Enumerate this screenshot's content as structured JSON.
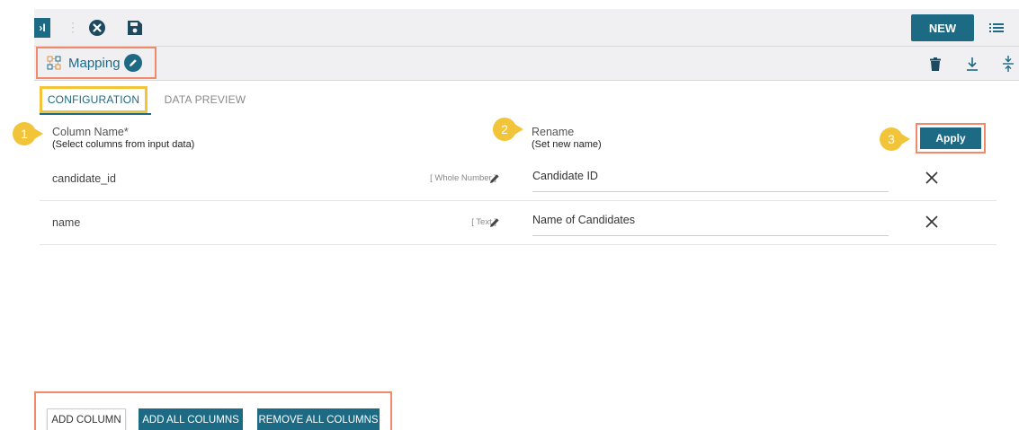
{
  "toolbar": {
    "collapse_icon": "›I",
    "new_label": "NEW",
    "accent": "#1d6a85"
  },
  "header": {
    "title": "Mapping"
  },
  "tabs": [
    {
      "label": "CONFIGURATION",
      "active": true
    },
    {
      "label": "DATA PREVIEW",
      "active": false
    }
  ],
  "callouts": [
    "1",
    "2",
    "3"
  ],
  "columns": {
    "name_header": "Column Name*",
    "name_sub": "(Select columns from input data)",
    "rename_header": "Rename",
    "rename_sub": "(Set new name)",
    "apply_label": "Apply"
  },
  "rows": [
    {
      "column": "candidate_id",
      "type": "[ Whole Number ]",
      "rename": "Candidate ID"
    },
    {
      "column": "name",
      "type": "[ Text ]",
      "rename": "Name of Candidates"
    }
  ],
  "actions": {
    "add_column": "ADD COLUMN",
    "add_all": "ADD ALL COLUMNS",
    "remove_all": "REMOVE ALL COLUMNS"
  },
  "colors": {
    "primary": "#1d6a85",
    "highlight_orange": "#f08a6a",
    "highlight_yellow": "#f2c43a"
  }
}
